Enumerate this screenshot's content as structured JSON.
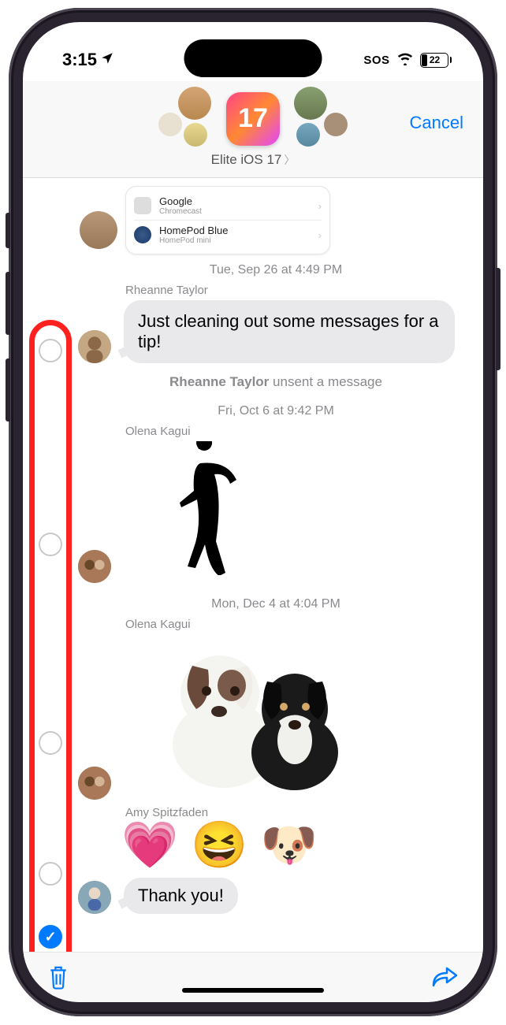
{
  "statusBar": {
    "time": "3:15",
    "sos": "SOS",
    "battery": "22"
  },
  "header": {
    "cancel": "Cancel",
    "centerBadge": "17",
    "groupName": "Elite iOS 17"
  },
  "card": {
    "row1": {
      "title": "Google",
      "sub": "Chromecast"
    },
    "row2": {
      "title": "HomePod Blue",
      "sub": "HomePod mini"
    }
  },
  "timeline": {
    "ts1": "Tue, Sep 26 at 4:49 PM",
    "sender1": "Rheanne Taylor",
    "msg1": "Just cleaning out some messages for a tip!",
    "unsent": "Rheanne Taylor unsent a message",
    "ts2": "Fri, Oct 6 at 9:42 PM",
    "sender2": "Olena Kagui",
    "ts3": "Mon, Dec 4 at 4:04 PM",
    "sender3": "Olena Kagui",
    "sender4": "Amy Spitzfaden",
    "emoji": "💗 😆 🐶",
    "msg2": "Thank you!"
  }
}
